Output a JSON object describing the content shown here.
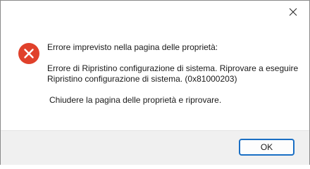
{
  "window": {
    "close_icon": "close-icon"
  },
  "message": {
    "icon": "error-icon",
    "heading": "Errore imprevisto nella pagina delle proprietà:",
    "detail_line1": "Errore di Ripristino configurazione di sistema. Riprovare a eseguire",
    "detail_line2": "Ripristino configurazione di sistema. (0x81000203)",
    "action": "Chiudere la pagina delle proprietà e riprovare."
  },
  "buttons": {
    "ok_label": "OK"
  },
  "colors": {
    "error_red": "#e0412b",
    "accent_border": "#1a6fc4",
    "footer_bg": "#f0f0f0"
  }
}
